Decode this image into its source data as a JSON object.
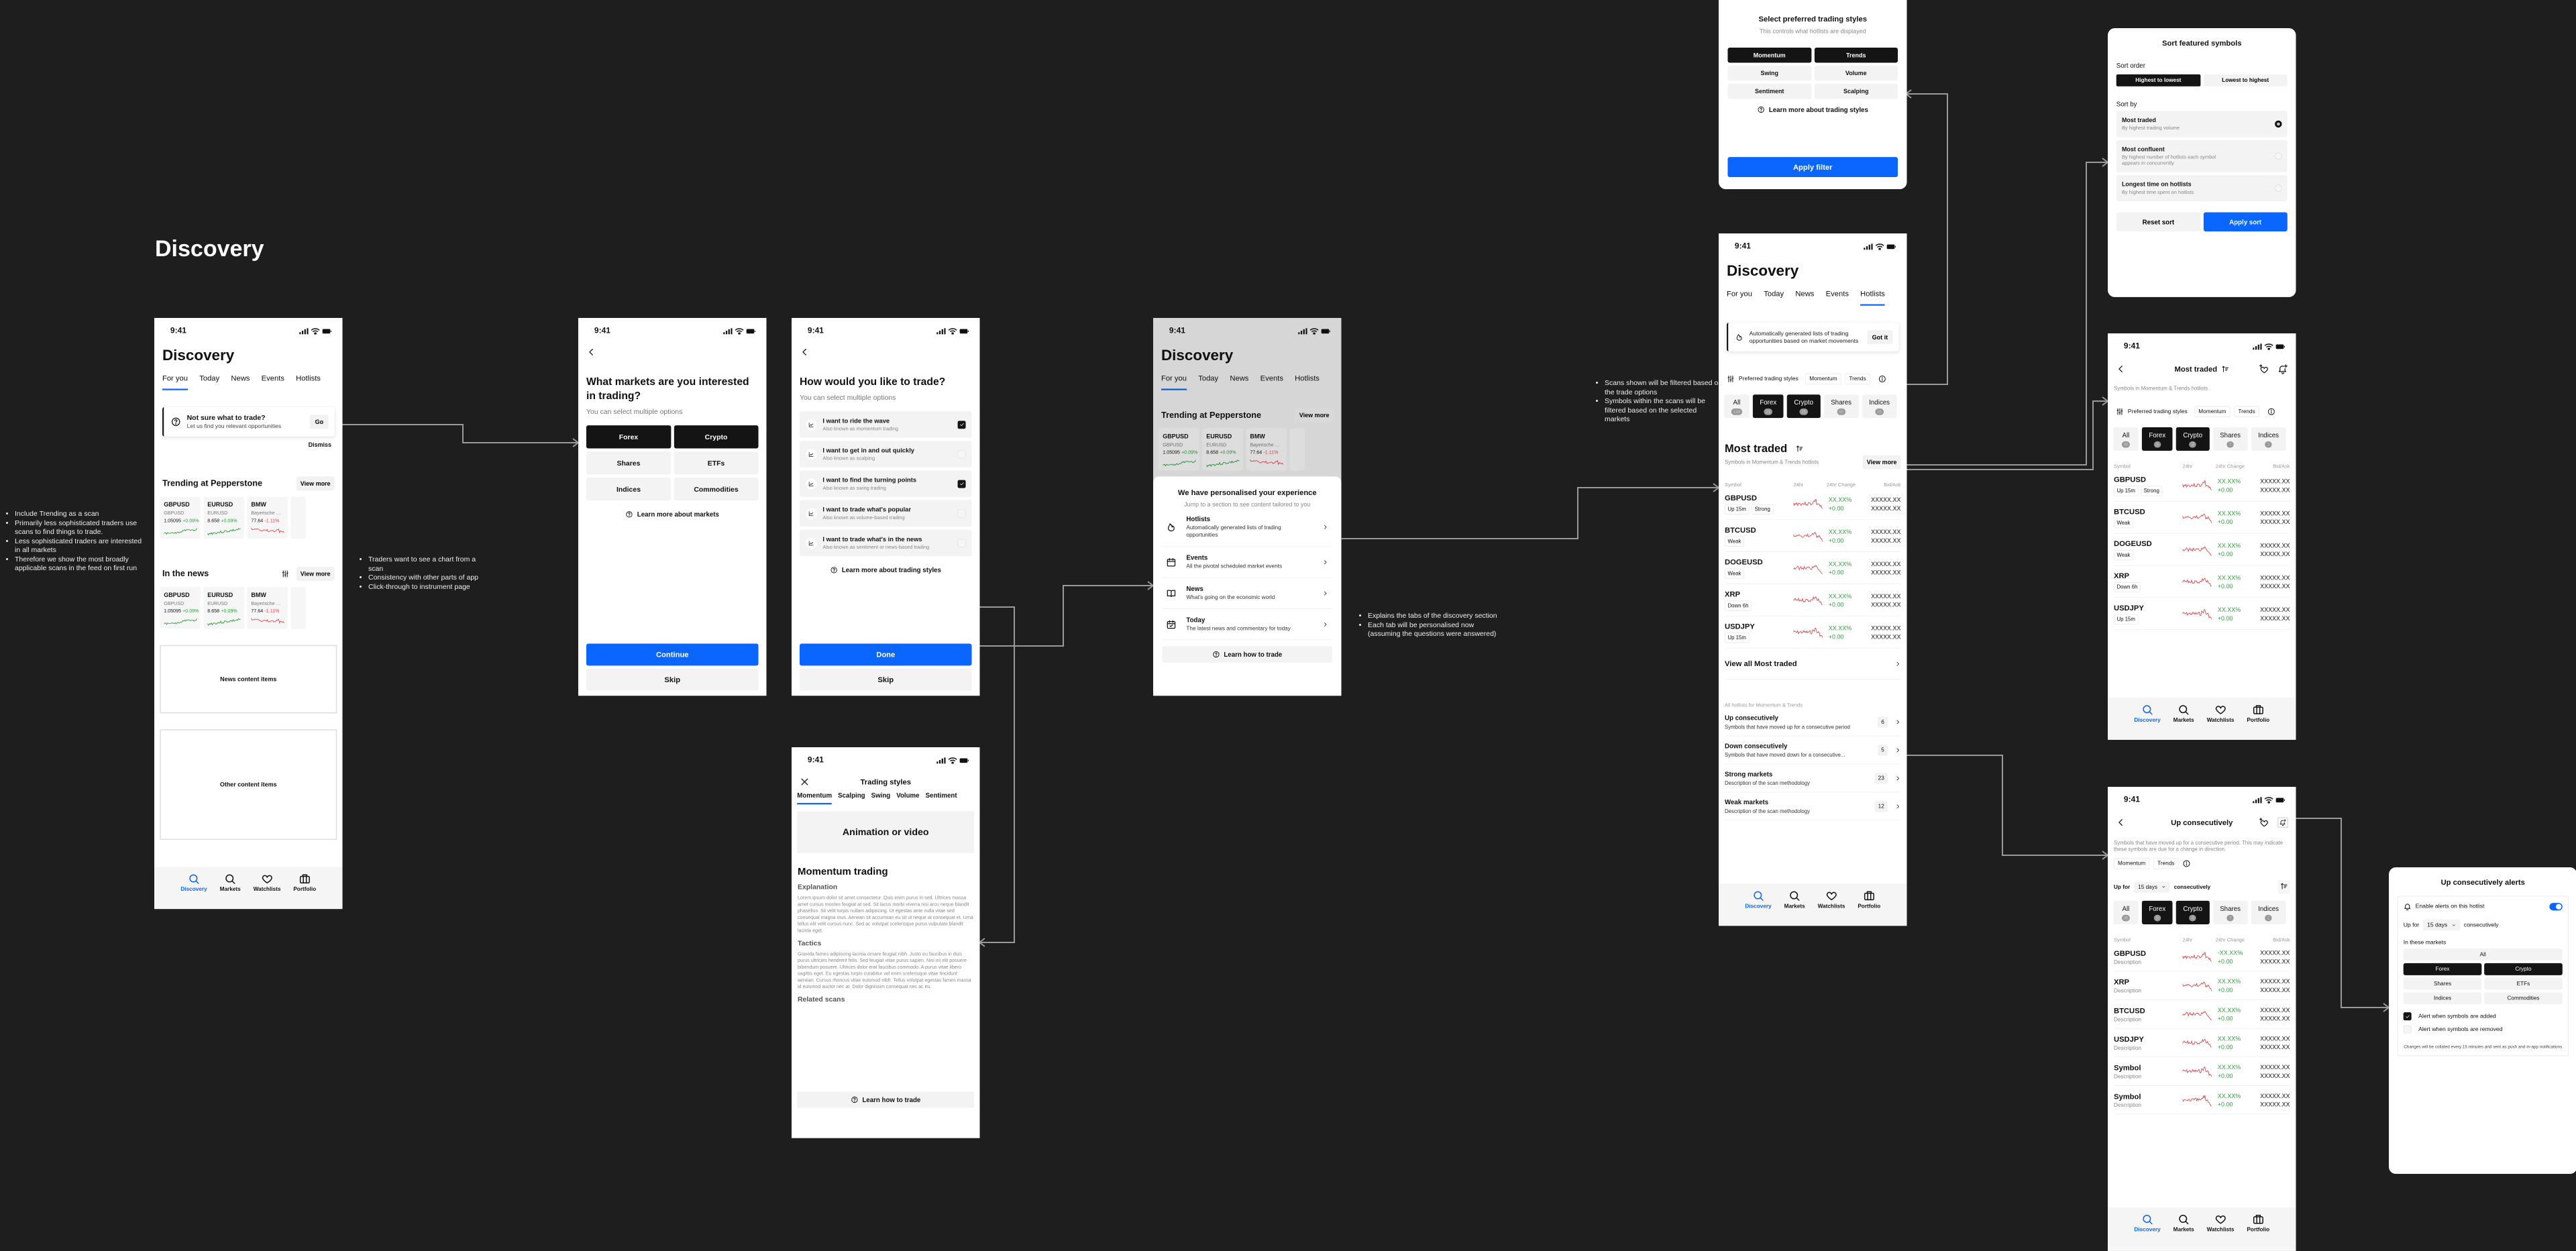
{
  "canvas": {
    "title": "Discovery",
    "background": "#1e1e1e"
  },
  "colors": {
    "accent": "#0a66ff",
    "positive": "#2e9e3e",
    "negative": "#e5484d",
    "selected": "#141414",
    "connector": "#9a9a9a"
  },
  "notes": [
    [
      "Include Trending as a scan",
      "Primarily less sophisticated traders use scans to find things to trade.",
      "Less sophisticated traders are interested in all markets",
      "Therefore we show the most broadly applicable scans in the feed on first run"
    ],
    [
      "Traders want to see a chart from a scan",
      "Consistency with other parts of app",
      "Click-through to instrument page"
    ],
    [
      "Explains the tabs of the discovery section",
      "Each tab will be personalised now (assuming the questions were answered)"
    ],
    [
      "Scans shown will be filtered based on the trade options",
      "Symbols within the scans will be filtered based on the selected markets"
    ]
  ],
  "status": {
    "time": "9:41"
  },
  "nav": [
    {
      "label": "Discovery",
      "icon": "search",
      "active": true
    },
    {
      "label": "Markets",
      "icon": "search",
      "active": false
    },
    {
      "label": "Watchlists",
      "icon": "heart",
      "active": false
    },
    {
      "label": "Portfolio",
      "icon": "briefcase",
      "active": false
    }
  ],
  "discovery": {
    "title": "Discovery",
    "tabs": [
      "For you",
      "Today",
      "News",
      "Events",
      "Hotlists"
    ],
    "banner": {
      "title": "Not sure what to trade?",
      "subtitle": "Let us find you relevant opportunities",
      "go": "Go",
      "dismiss": "Dismiss"
    },
    "trending": {
      "title": "Trending at Pepperstone",
      "view_more": "View more",
      "cards": [
        {
          "symbol": "GBPUSD",
          "name": "GBPUSD",
          "price": "1.05095",
          "change": "+0.09%",
          "dir": "up"
        },
        {
          "symbol": "EURUSD",
          "name": "EURUSD",
          "price": "8.658",
          "change": "+0.09%",
          "dir": "up"
        },
        {
          "symbol": "BMW",
          "name": "Bayerische Mot...",
          "price": "77.64",
          "change": "-1.11%",
          "dir": "down"
        }
      ]
    },
    "news": {
      "title": "In the news",
      "view_more": "View more",
      "cards": [
        {
          "symbol": "GBPUSD",
          "name": "GBPUSD",
          "price": "1.05095",
          "change": "+0.09%",
          "dir": "up"
        },
        {
          "symbol": "EURUSD",
          "name": "EURUSD",
          "price": "8.658",
          "change": "+0.09%",
          "dir": "up"
        },
        {
          "symbol": "BMW",
          "name": "Bayerische Mot...",
          "price": "77.64",
          "change": "-1.11%",
          "dir": "down"
        }
      ]
    },
    "placeholders": [
      "News content items",
      "Other content items"
    ]
  },
  "markets_question": {
    "title": "What markets are you interested in trading?",
    "subtitle": "You can select multiple options",
    "options": [
      {
        "label": "Forex",
        "selected": true
      },
      {
        "label": "Crypto",
        "selected": true
      },
      {
        "label": "Shares",
        "selected": false
      },
      {
        "label": "ETFs",
        "selected": false
      },
      {
        "label": "Indices",
        "selected": false
      },
      {
        "label": "Commodities",
        "selected": false
      }
    ],
    "learn": "Learn more about markets",
    "continue": "Continue",
    "skip": "Skip"
  },
  "trade_question": {
    "title": "How would you like to trade?",
    "subtitle": "You can select multiple options",
    "options": [
      {
        "title": "I want to ride the wave",
        "subtitle": "Also known as momentum trading",
        "checked": true
      },
      {
        "title": "I want to get in and out quickly",
        "subtitle": "Also known as scalping",
        "checked": false
      },
      {
        "title": "I want to find the turning points",
        "subtitle": "Also known as swing trading",
        "checked": true
      },
      {
        "title": "I want to trade what's popular",
        "subtitle": "Also known as volume-based trading",
        "checked": false
      },
      {
        "title": "I want to trade what's in the news",
        "subtitle": "Also known as sentiment or news-based trading",
        "checked": false
      }
    ],
    "learn": "Learn more about trading styles",
    "done": "Done",
    "skip": "Skip"
  },
  "trading_styles": {
    "title": "Trading styles",
    "tabs": [
      "Momentum",
      "Scalping",
      "Swing",
      "Volume",
      "Sentiment"
    ],
    "media": "Animation or video",
    "heading": "Momentum trading",
    "sections": [
      {
        "heading": "Explanation",
        "body": "Lorem ipsum dolor sit amet consectetur. Quis enim purus in sed. Ultrices massa amet cursus montes feugiat at sed. Sit lacus morbi viverra nisi arcu neque blandit phasellus. Sit velit turpis nullam adipiscing. Ut egestas ante nulla vitae sed consequat magna mus. Aenean sit accumsan eu sit ut neque at consequat et. Urna tellus elit velit cursus nunc. Sed ac volutpat scelerisque purus vulputate blandit lacinia eget."
      },
      {
        "heading": "Tactics",
        "body": "Gravida fames adipiscing lacinia ornare feugiat nibh. Justo eu faucibus in duis purus ultricies hendrerit felis. Sed feugiat vitae purus sapien. Nisi mi elit posuere bibendum posuere. Ultrices dolor erat faucibus commodo. A purus vitae libero sagittis eget. Eu egestas turpis curabitur vel enim scelerisque vitae tincidunt aenean. Cursus rhoncus vitae euismod nibh. Tellus volutpat egestas fames massa id euismod auctor nec at. Dolor dignissim consequat nec ac eu."
      }
    ],
    "related": "Related scans",
    "learn": "Learn how to trade"
  },
  "personalised": {
    "title": "We have personalised your experience",
    "subtitle": "Jump to a section to see content tailored to you",
    "items": [
      {
        "title": "Hotlists",
        "subtitle": "Automatically generated lists of trading opportunities",
        "icon": "flame"
      },
      {
        "title": "Events",
        "subtitle": "All the pivotal scheduled market events",
        "icon": "calendar"
      },
      {
        "title": "News",
        "subtitle": "What's going on the economic world",
        "icon": "book"
      },
      {
        "title": "Today",
        "subtitle": "The latest news and commentary for today",
        "icon": "calendar-check"
      }
    ],
    "learn": "Learn how to trade"
  },
  "filter_sheet": {
    "title": "Select preferred trading styles",
    "subtitle": "This controls what hotlists are displayed",
    "options": [
      {
        "label": "Momentum",
        "selected": true
      },
      {
        "label": "Trends",
        "selected": true
      },
      {
        "label": "Swing",
        "selected": false
      },
      {
        "label": "Volume",
        "selected": false
      },
      {
        "label": "Sentiment",
        "selected": false
      },
      {
        "label": "Scalping",
        "selected": false
      }
    ],
    "learn": "Learn more about trading styles",
    "apply": "Apply filter"
  },
  "table_columns": [
    "Symbol",
    "24hr",
    "24hr Change",
    "Bid/Ask"
  ],
  "hotlists": {
    "banner": {
      "text": "Automatically generated lists of trading opportunities based on market movements",
      "button": "Got it"
    },
    "preferred": {
      "label": "Preferred trading styles",
      "chips": [
        "Momentum",
        "Trends"
      ]
    },
    "markets": [
      {
        "label": "All",
        "count": "134",
        "selected": false
      },
      {
        "label": "Forex",
        "count": "21",
        "selected": true
      },
      {
        "label": "Crypto",
        "count": "25",
        "selected": true
      },
      {
        "label": "Shares",
        "count": "60",
        "selected": false
      },
      {
        "label": "Indices",
        "count": "25",
        "selected": false
      }
    ],
    "most_traded": {
      "title": "Most traded",
      "subtitle": "Symbols in Momentum & Trends hotlists",
      "view_more": "View more",
      "rows": [
        {
          "symbol": "GBPUSD",
          "tags": [
            "Up 15m",
            "Strong"
          ],
          "change_pct": "XX.XX%",
          "change_abs": "+0.00",
          "bid": "XXXXX.XX",
          "ask": "XXXXX.XX"
        },
        {
          "symbol": "BTCUSD",
          "tags": [
            "Weak"
          ],
          "change_pct": "XX.XX%",
          "change_abs": "+0.00",
          "bid": "XXXXX.XX",
          "ask": "XXXXX.XX"
        },
        {
          "symbol": "DOGEUSD",
          "tags": [
            "Weak"
          ],
          "change_pct": "XX.XX%",
          "change_abs": "+0.00",
          "bid": "XXXXX.XX",
          "ask": "XXXXX.XX"
        },
        {
          "symbol": "XRP",
          "tags": [
            "Down 6h"
          ],
          "change_pct": "XX.XX%",
          "change_abs": "+0.00",
          "bid": "XXXXX.XX",
          "ask": "XXXXX.XX"
        },
        {
          "symbol": "USDJPY",
          "tags": [
            "Up 15m"
          ],
          "change_pct": "XX.XX%",
          "change_abs": "+0.00",
          "bid": "XXXXX.XX",
          "ask": "XXXXX.XX"
        }
      ],
      "view_all": "View all  Most traded"
    },
    "all_label": "All hotlists for Momentum & Trends",
    "scans": [
      {
        "title": "Up consecutively",
        "desc": "Symbols that have moved up for a consecutive period",
        "count": "6"
      },
      {
        "title": "Down consecutively",
        "desc": "Symbols that have moved down for a consecutive...",
        "count": "5"
      },
      {
        "title": "Strong markets",
        "desc": "Description of the scan methodology",
        "count": "23"
      },
      {
        "title": "Weak markets",
        "desc": "Description of the scan methodology",
        "count": "12"
      }
    ]
  },
  "sort_sheet": {
    "title": "Sort featured symbols",
    "order_label": "Sort order",
    "orders": [
      {
        "label": "Highest to lowest",
        "selected": true
      },
      {
        "label": "Lowest to highest",
        "selected": false
      }
    ],
    "by_label": "Sort by",
    "options": [
      {
        "title": "Most traded",
        "subtitle": "By highest trading volume",
        "selected": true
      },
      {
        "title": "Most confluent",
        "subtitle": "By highest number of hotlists each symbol appears in concurrently",
        "selected": false
      },
      {
        "title": "Longest time on hotlists",
        "subtitle": "By highest time spent on hotlists",
        "selected": false
      }
    ],
    "reset": "Reset sort",
    "apply": "Apply sort"
  },
  "most_traded_page": {
    "title": "Most traded",
    "subtitle": "Symbols in Momentum & Trends hotlists",
    "markets": [
      {
        "label": "All",
        "count": "36",
        "selected": false
      },
      {
        "label": "Forex",
        "count": "3",
        "selected": true
      },
      {
        "label": "Crypto",
        "count": "3",
        "selected": true
      },
      {
        "label": "Shares",
        "count": "7",
        "selected": false
      },
      {
        "label": "Indices",
        "count": "1",
        "selected": false
      }
    ]
  },
  "up_page": {
    "title": "Up consecutively",
    "description": "Symbols that have moved up for a consecutive period. This may indicate these symbols are due for a change in direction.",
    "chips": [
      "Momentum",
      "Trends"
    ],
    "up_for": "Up for",
    "period": "15 days",
    "consecutively": "consecutively",
    "rows": [
      {
        "symbol": "GBPUSD",
        "desc": "Description",
        "change_pct": "-XX.XX%",
        "change_abs": "+0.00",
        "bid": "XXXXX.XX",
        "ask": "XXXXX.XX"
      },
      {
        "symbol": "XRP",
        "desc": "Description",
        "change_pct": "XX.XX%",
        "change_abs": "+0.00",
        "bid": "XXXXX.XX",
        "ask": "XXXXX.XX"
      },
      {
        "symbol": "BTCUSD",
        "desc": "Description",
        "change_pct": "XX.XX%",
        "change_abs": "+0.00",
        "bid": "XXXXX.XX",
        "ask": "XXXXX.XX"
      },
      {
        "symbol": "USDJPY",
        "desc": "Description",
        "change_pct": "XX.XX%",
        "change_abs": "+0.00",
        "bid": "XXXXX.XX",
        "ask": "XXXXX.XX"
      },
      {
        "symbol": "Symbol",
        "desc": "Description",
        "change_pct": "XX.XX%",
        "change_abs": "+0.00",
        "bid": "XXXXX.XX",
        "ask": "XXXXX.XX"
      },
      {
        "symbol": "Symbol",
        "desc": "Description",
        "change_pct": "XX.XX%",
        "change_abs": "+0.00",
        "bid": "XXXXX.XX",
        "ask": "XXXXX.XX"
      }
    ]
  },
  "alerts_sheet": {
    "title": "Up consecutively alerts",
    "enable": "Enable alerts on this hotlist",
    "enabled": true,
    "up_for": "Up for",
    "period": "15 days",
    "consecutively": "consecutively",
    "markets_label": "In these markets",
    "options": [
      {
        "label": "All",
        "selected": false,
        "full": true
      },
      {
        "label": "Forex",
        "selected": true
      },
      {
        "label": "Crypto",
        "selected": true
      },
      {
        "label": "Shares",
        "selected": false
      },
      {
        "label": "ETFs",
        "selected": false
      },
      {
        "label": "Indices",
        "selected": false
      },
      {
        "label": "Commodities",
        "selected": false
      }
    ],
    "checks": [
      {
        "label": "Alert when symbols are added",
        "checked": true
      },
      {
        "label": "Alert when symbols are removed",
        "checked": false
      }
    ],
    "footnote": "Changes will be collated every 15 minutes and sent as push and in-app notifications"
  }
}
